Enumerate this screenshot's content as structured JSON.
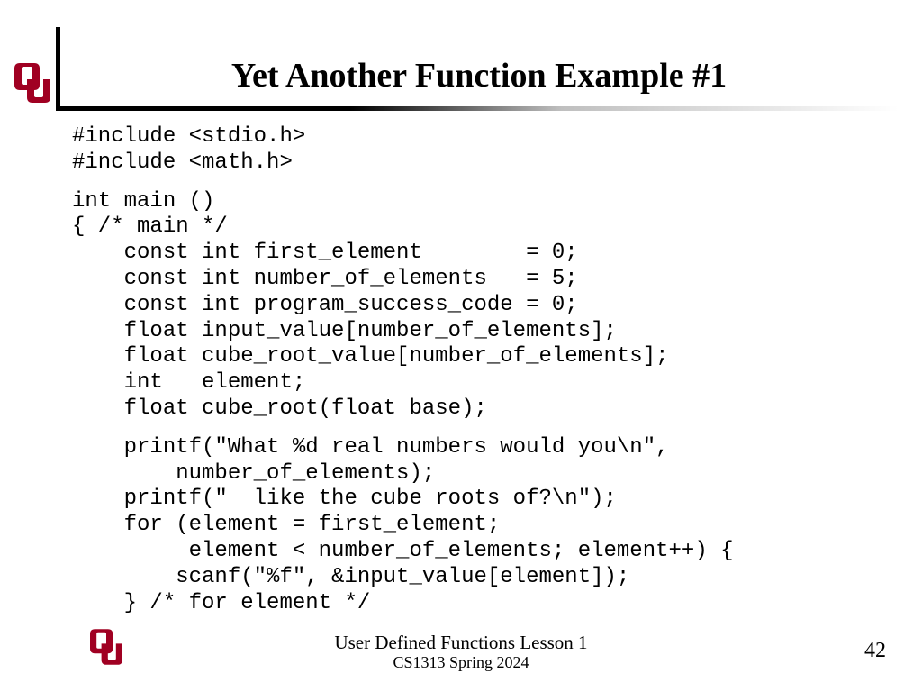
{
  "title": "Yet Another Function Example #1",
  "code": {
    "l01": "#include <stdio.h>",
    "l02": "#include <math.h>",
    "l03": "int main ()",
    "l04": "{ /* main */",
    "l05": "    const int first_element        = 0;",
    "l06": "    const int number_of_elements   = 5;",
    "l07": "    const int program_success_code = 0;",
    "l08": "    float input_value[number_of_elements];",
    "l09": "    float cube_root_value[number_of_elements];",
    "l10": "    int   element;",
    "l11": "    float cube_root(float base);",
    "l12": "    printf(\"What %d real numbers would you\\n\",",
    "l13": "        number_of_elements);",
    "l14": "    printf(\"  like the cube roots of?\\n\");",
    "l15": "    for (element = first_element;",
    "l16": "         element < number_of_elements; element++) {",
    "l17": "        scanf(\"%f\", &input_value[element]);",
    "l18": "    } /* for element */"
  },
  "footer": {
    "line1": "User Defined Functions Lesson 1",
    "line2": "CS1313 Spring 2024"
  },
  "page_number": "42",
  "logo": {
    "color": "#a00022",
    "letters": "OU"
  }
}
